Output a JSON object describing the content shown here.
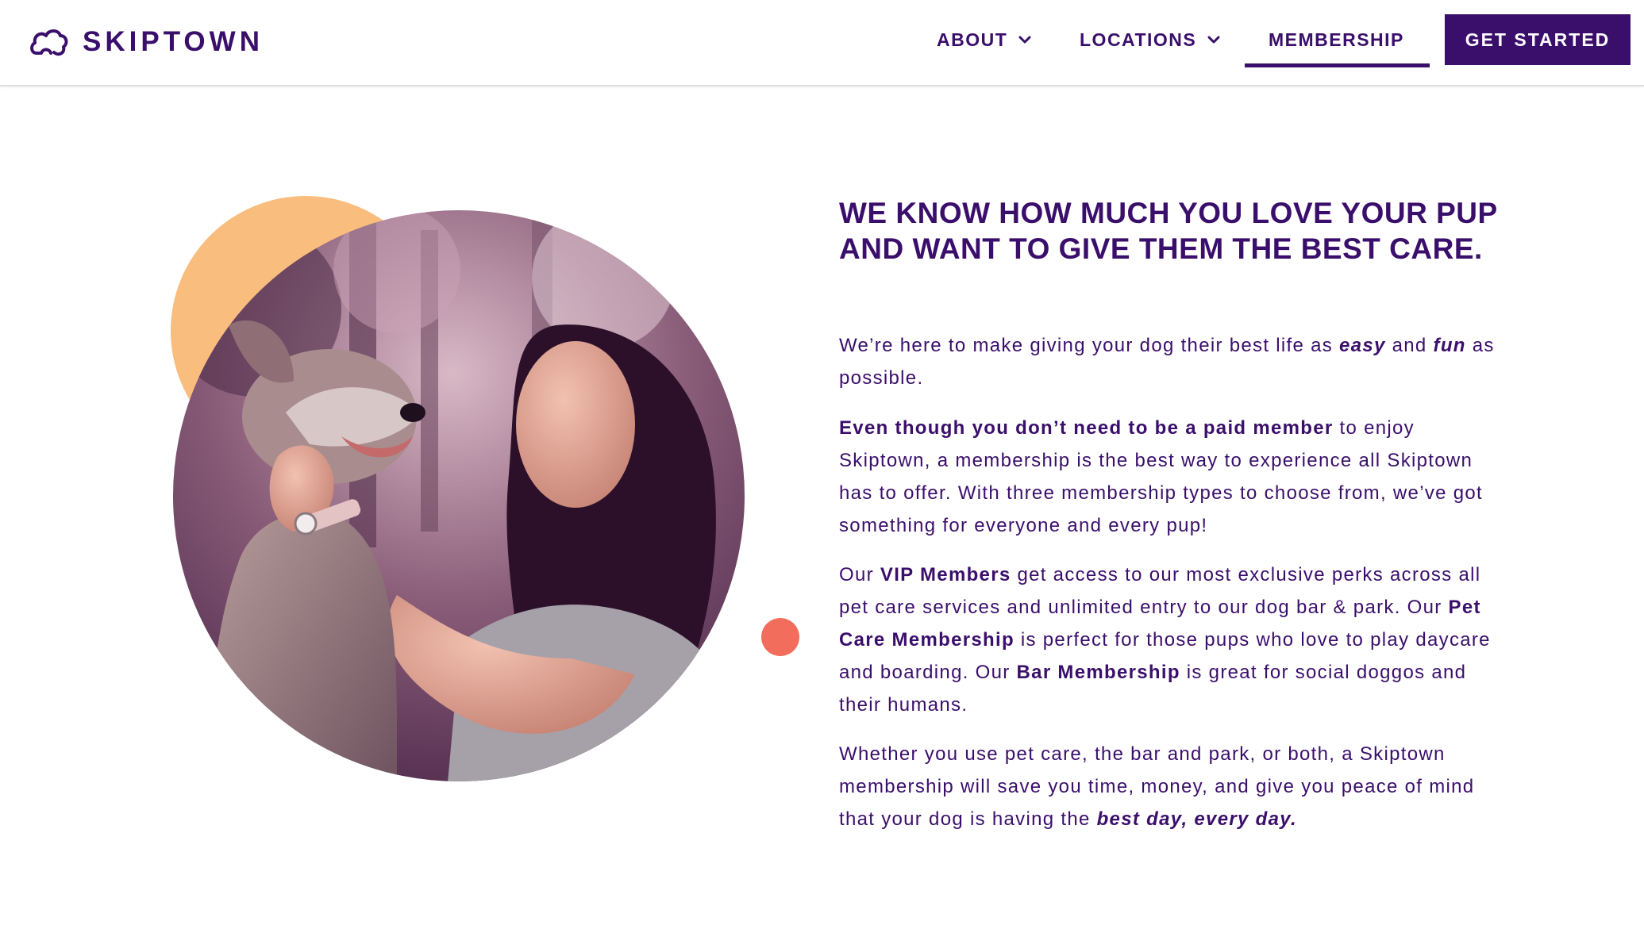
{
  "brand": {
    "name": "SKIPTOWN",
    "colors": {
      "primary": "#3a0e6b",
      "orange_blob": "#f9bd7e",
      "coral_dot": "#f26d5b",
      "white": "#ffffff"
    }
  },
  "nav": {
    "about": "ABOUT",
    "locations": "LOCATIONS",
    "membership": "MEMBERSHIP",
    "active_item": "MEMBERSHIP",
    "cta": "GET STARTED"
  },
  "hero": {
    "headline": "WE KNOW HOW MUCH YOU LOVE YOUR PUP AND WANT TO GIVE THEM THE BEST CARE.",
    "p1": {
      "t1": "We’re here to make giving your dog their best life as ",
      "em1": "easy",
      "t2": " and ",
      "em2": "fun",
      "t3": " as possible."
    },
    "p2": {
      "b1": "Even though you don’t need to be a paid member",
      "t1": " to enjoy Skiptown, a membership is the best way to experience all Skiptown has to offer. With three membership types to choose from, we’ve got something for everyone and every pup!"
    },
    "p3": {
      "t1": "Our ",
      "b1": "VIP Members",
      "t2": " get access to our most exclusive perks across all pet care services and unlimited entry to our dog bar & park. Our ",
      "b2": "Pet Care Membership",
      "t3": " is perfect for those pups who love to play daycare and boarding. Our ",
      "b3": "Bar Membership",
      "t4": " is great for social doggos and their humans."
    },
    "p4": {
      "t1": "Whether you use pet care, the bar and park, or both, a Skiptown membership will save you time, money, and give you peace of mind that your dog is having the ",
      "em1": "best day, every day."
    }
  },
  "icons": {
    "logo": "paw-cloud-logo-icon",
    "chevron": "chevron-down-icon"
  }
}
